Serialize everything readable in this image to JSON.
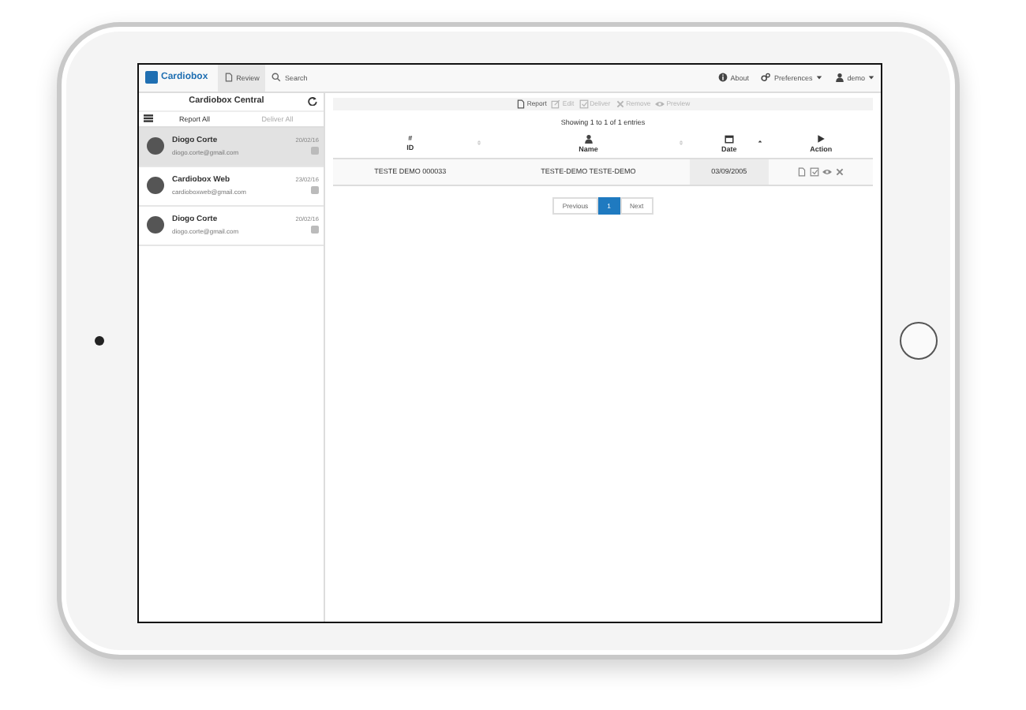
{
  "navbar": {
    "brand": "Cardiobox",
    "tabs": [
      {
        "label": "Review",
        "kind": "review",
        "selected": true
      },
      {
        "label": "Search",
        "kind": "search",
        "selected": false
      }
    ],
    "right": [
      {
        "label": "About",
        "kind": "info"
      },
      {
        "label": "Preferences",
        "kind": "prefs"
      },
      {
        "label": "demo",
        "kind": "user"
      }
    ]
  },
  "sidebar": {
    "title": "Cardiobox Central",
    "actions": [
      {
        "label": "Report All",
        "disabled": false
      },
      {
        "label": "Deliver All",
        "disabled": true
      }
    ],
    "items": [
      {
        "name": "Diogo Corte",
        "email": "diogo.corte@gmail.com",
        "date": "20/02/16",
        "selected": true
      },
      {
        "name": "Cardiobox Web",
        "email": "cardioboxweb@gmail.com",
        "date": "23/02/16",
        "selected": false
      },
      {
        "name": "Diogo Corte",
        "email": "diogo.corte@gmail.com",
        "date": "20/02/16",
        "selected": false
      }
    ]
  },
  "toolbar": [
    {
      "label": "Report",
      "kind": "report",
      "disabled": false
    },
    {
      "label": "Edit",
      "kind": "edit",
      "disabled": true
    },
    {
      "label": "Deliver",
      "kind": "deliver",
      "disabled": true
    },
    {
      "label": "Remove",
      "kind": "remove",
      "disabled": true
    },
    {
      "label": "Preview",
      "kind": "preview",
      "disabled": true
    }
  ],
  "table": {
    "info": "Showing 1 to 1 of 1 entries",
    "columns": [
      {
        "kind": "hash",
        "symbol": "#",
        "label": "ID",
        "sortable": true,
        "sorted": false
      },
      {
        "kind": "user",
        "label": "Name",
        "sortable": true,
        "sorted": false
      },
      {
        "kind": "calendar",
        "label": "Date",
        "sortable": true,
        "sorted": true
      },
      {
        "kind": "play",
        "label": "Action",
        "sortable": false,
        "sorted": false
      }
    ],
    "rows": [
      {
        "cells": [
          "TESTE DEMO 000033",
          "TESTE-DEMO TESTE-DEMO",
          "03/09/2005"
        ]
      }
    ]
  },
  "pagination": {
    "previous": "Previous",
    "pages": [
      {
        "label": "1",
        "selected": true
      }
    ],
    "next": "Next"
  }
}
